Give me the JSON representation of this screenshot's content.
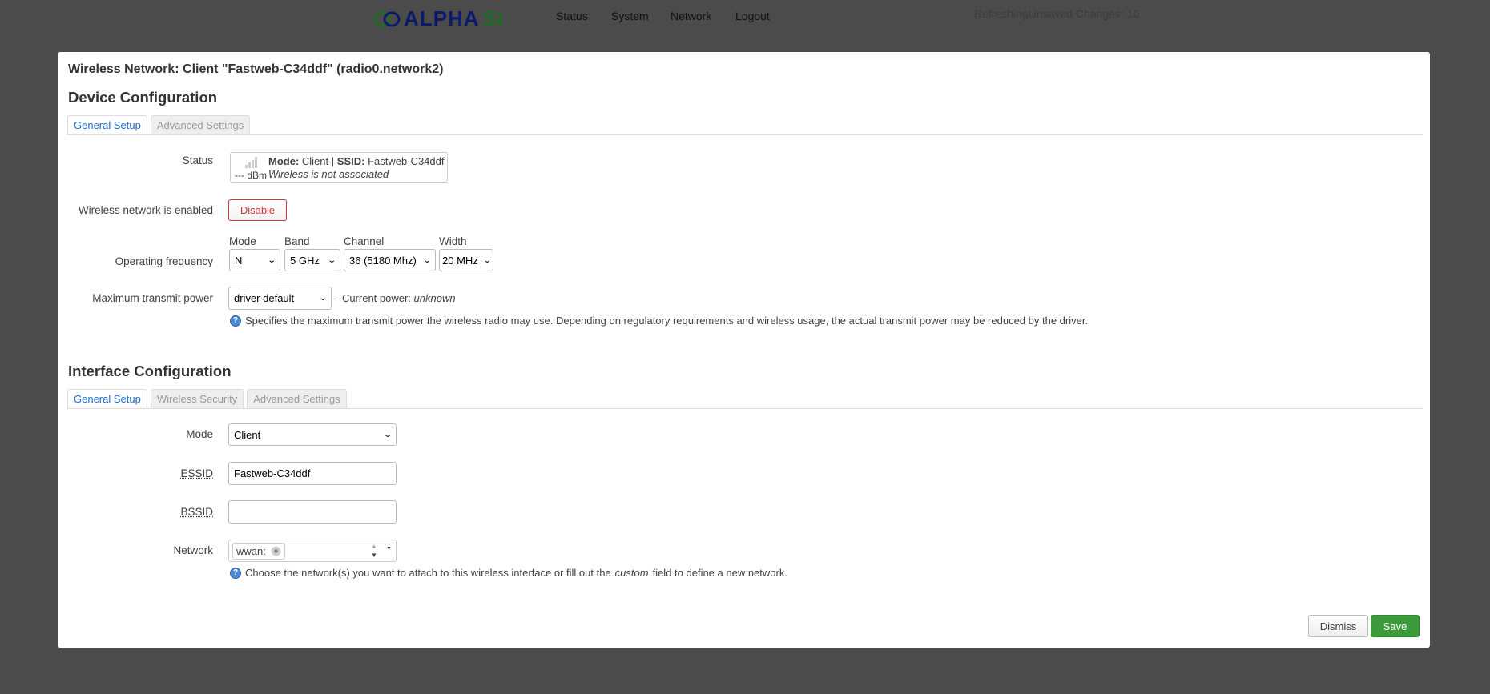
{
  "header": {
    "brand": "alphaSI",
    "brand_a": "ALPHA",
    "brand_b": "SI",
    "nav": [
      "Status",
      "System",
      "Network",
      "Logout"
    ],
    "status_text": "RefreshingUnsaved Changes: 10"
  },
  "colors": {
    "accent": "#1b6fd0",
    "save": "#3c9a3c",
    "disable": "#d0383c"
  },
  "modal": {
    "title": "Wireless Network: Client \"Fastweb-C34ddf\" (radio0.network2)",
    "device": {
      "heading": "Device Configuration",
      "tabs": [
        "General Setup",
        "Advanced Settings"
      ],
      "status_label": "Status",
      "status": {
        "signal": "--- dBm",
        "mode_label": "Mode:",
        "mode": "Client",
        "sep": "|",
        "ssid_label": "SSID:",
        "ssid": "Fastweb-C34ddf",
        "assoc": "Wireless is not associated"
      },
      "enabled_label": "Wireless network is enabled",
      "disable_button": "Disable",
      "freq_label": "Operating frequency",
      "freq": {
        "mode_label": "Mode",
        "mode": "N",
        "band_label": "Band",
        "band": "5 GHz",
        "channel_label": "Channel",
        "channel": "36 (5180 Mhz)",
        "width_label": "Width",
        "width": "20 MHz"
      },
      "power_label": "Maximum transmit power",
      "power": "driver default",
      "current_power_prefix": "- Current power:",
      "current_power": "unknown",
      "power_help": "Specifies the maximum transmit power the wireless radio may use. Depending on regulatory requirements and wireless usage, the actual transmit power may be reduced by the driver."
    },
    "iface": {
      "heading": "Interface Configuration",
      "tabs": [
        "General Setup",
        "Wireless Security",
        "Advanced Settings"
      ],
      "mode_label": "Mode",
      "mode": "Client",
      "essid_label": "ESSID",
      "essid": "Fastweb-C34ddf",
      "bssid_label": "BSSID",
      "bssid": "",
      "network_label": "Network",
      "network_tag": "wwan:",
      "network_help_a": "Choose the network(s) you want to attach to this wireless interface or fill out the",
      "network_help_em": "custom",
      "network_help_b": "field to define a new network."
    },
    "dismiss": "Dismiss",
    "save": "Save"
  }
}
